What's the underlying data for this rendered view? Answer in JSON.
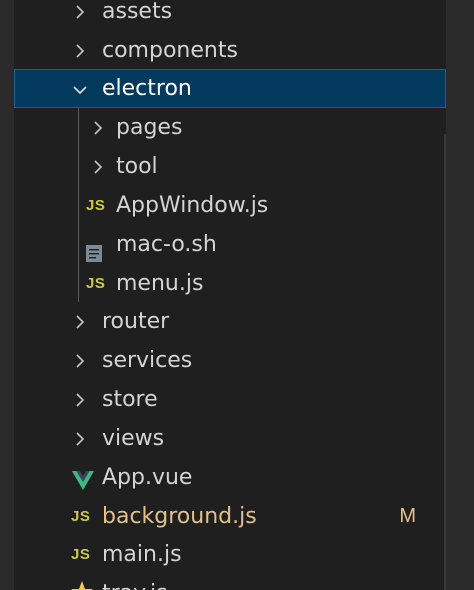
{
  "explorer": {
    "items": [
      {
        "label": "assets",
        "kind": "folder",
        "expanded": false
      },
      {
        "label": "components",
        "kind": "folder",
        "expanded": false
      },
      {
        "label": "electron",
        "kind": "folder",
        "expanded": true,
        "selected": true
      },
      {
        "label": "pages",
        "kind": "folder",
        "expanded": false
      },
      {
        "label": "tool",
        "kind": "folder",
        "expanded": false
      },
      {
        "label": "AppWindow.js",
        "kind": "file",
        "icon": "js-icon",
        "icon_text": "JS"
      },
      {
        "label": "mac-o.sh",
        "kind": "file",
        "icon": "shell-file-icon"
      },
      {
        "label": "menu.js",
        "kind": "file",
        "icon": "js-icon",
        "icon_text": "JS"
      },
      {
        "label": "router",
        "kind": "folder",
        "expanded": false
      },
      {
        "label": "services",
        "kind": "folder",
        "expanded": false
      },
      {
        "label": "store",
        "kind": "folder",
        "expanded": false
      },
      {
        "label": "views",
        "kind": "folder",
        "expanded": false
      },
      {
        "label": "App.vue",
        "kind": "file",
        "icon": "vue-icon"
      },
      {
        "label": "background.js",
        "kind": "file",
        "icon": "js-icon",
        "icon_text": "JS",
        "status": "M"
      },
      {
        "label": "main.js",
        "kind": "file",
        "icon": "js-icon",
        "icon_text": "JS"
      },
      {
        "label": "tray.js",
        "kind": "file",
        "icon": "star-icon"
      }
    ]
  },
  "colors": {
    "background": "#1f1f20",
    "selection": "#04395e",
    "selection_border": "#0e639c",
    "text": "#d4d4d4",
    "js_icon": "#cbcb41",
    "modified": "#e2c08d",
    "vue_green": "#41b883",
    "star_yellow": "#f2c94c"
  }
}
